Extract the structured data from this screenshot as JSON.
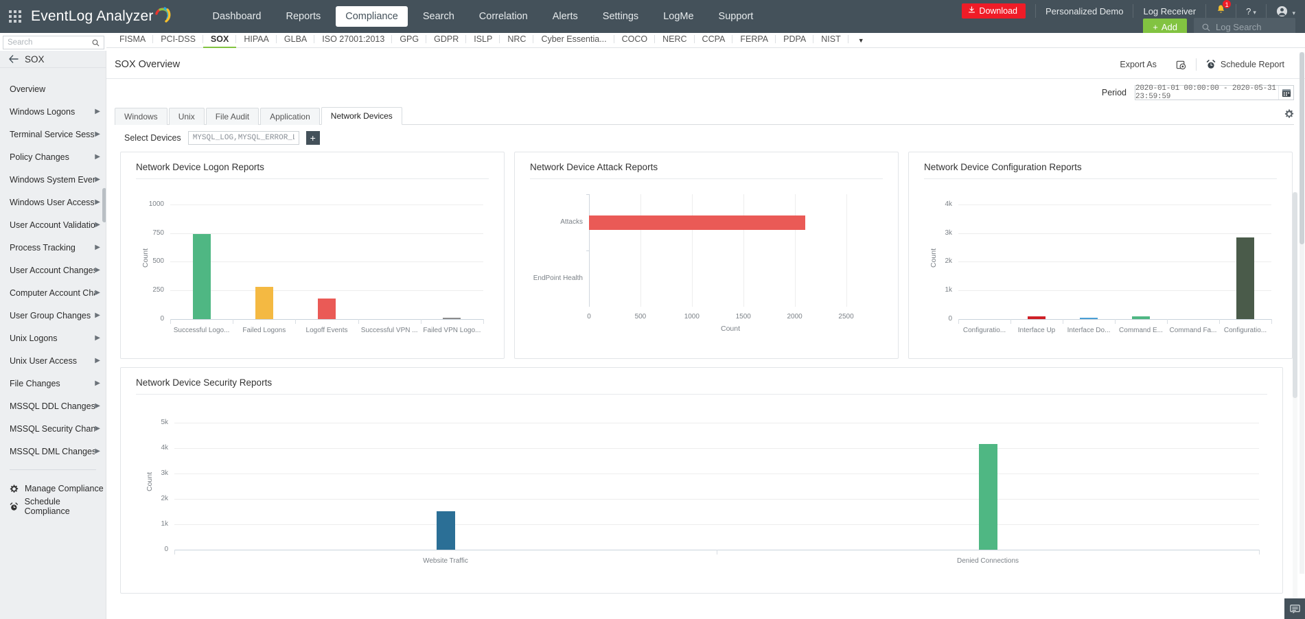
{
  "app": {
    "brand": "EventLog Analyzer",
    "grid_icon": "apps-grid-icon"
  },
  "topnav": {
    "items": [
      {
        "label": "Dashboard",
        "active": false
      },
      {
        "label": "Reports",
        "active": false
      },
      {
        "label": "Compliance",
        "active": true
      },
      {
        "label": "Search",
        "active": false
      },
      {
        "label": "Correlation",
        "active": false
      },
      {
        "label": "Alerts",
        "active": false
      },
      {
        "label": "Settings",
        "active": false
      },
      {
        "label": "LogMe",
        "active": false
      },
      {
        "label": "Support",
        "active": false
      }
    ]
  },
  "topright": {
    "download_label": "Download",
    "personalized_demo": "Personalized Demo",
    "log_receiver": "Log Receiver",
    "notification_count": "1",
    "help_label": "?",
    "add_label": "Add",
    "log_search_placeholder": "Log Search",
    "accent_red": "#ef1c27",
    "accent_green": "#82c341",
    "bar_bg": "#44515a"
  },
  "sidebar_search": {
    "placeholder": "Search"
  },
  "compliance_tabs": {
    "items": [
      {
        "label": "FISMA",
        "active": false
      },
      {
        "label": "PCI-DSS",
        "active": false
      },
      {
        "label": "SOX",
        "active": true
      },
      {
        "label": "HIPAA",
        "active": false
      },
      {
        "label": "GLBA",
        "active": false
      },
      {
        "label": "ISO 27001:2013",
        "active": false
      },
      {
        "label": "GPG",
        "active": false
      },
      {
        "label": "GDPR",
        "active": false
      },
      {
        "label": "ISLP",
        "active": false
      },
      {
        "label": "NRC",
        "active": false
      },
      {
        "label": "Cyber Essentia...",
        "active": false
      },
      {
        "label": "COCO",
        "active": false
      },
      {
        "label": "NERC",
        "active": false
      },
      {
        "label": "CCPA",
        "active": false
      },
      {
        "label": "FERPA",
        "active": false
      },
      {
        "label": "PDPA",
        "active": false
      },
      {
        "label": "NIST",
        "active": false
      }
    ]
  },
  "sidebar": {
    "header_title": "SOX",
    "items": [
      {
        "label": "Overview",
        "has_arrow": false
      },
      {
        "label": "Windows Logons",
        "has_arrow": true
      },
      {
        "label": "Terminal Service Sessi...",
        "has_arrow": true
      },
      {
        "label": "Policy Changes",
        "has_arrow": true
      },
      {
        "label": "Windows System Events",
        "has_arrow": true
      },
      {
        "label": "Windows User Access",
        "has_arrow": true
      },
      {
        "label": "User Account Validatio...",
        "has_arrow": true
      },
      {
        "label": "Process Tracking",
        "has_arrow": true
      },
      {
        "label": "User Account Changes",
        "has_arrow": true
      },
      {
        "label": "Computer Account Chang...",
        "has_arrow": true
      },
      {
        "label": "User Group Changes",
        "has_arrow": true
      },
      {
        "label": "Unix Logons",
        "has_arrow": true
      },
      {
        "label": "Unix User Access",
        "has_arrow": true
      },
      {
        "label": "File Changes",
        "has_arrow": true
      },
      {
        "label": "MSSQL DDL Changes",
        "has_arrow": true
      },
      {
        "label": "MSSQL Security Changes",
        "has_arrow": true
      },
      {
        "label": "MSSQL DML Changes",
        "has_arrow": true
      }
    ],
    "bottom_items": [
      {
        "label": "Manage Compliance",
        "icon": "gear-icon"
      },
      {
        "label": "Schedule Compliance",
        "icon": "alarm-clock-icon"
      }
    ]
  },
  "content_header": {
    "page_title": "SOX Overview",
    "export_as": "Export As",
    "schedule_report": "Schedule Report"
  },
  "period": {
    "label": "Period",
    "value": "2020-01-01 00:00:00 - 2020-05-31 23:59:59"
  },
  "page_tabs": {
    "items": [
      {
        "label": "Windows",
        "active": false
      },
      {
        "label": "Unix",
        "active": false
      },
      {
        "label": "File Audit",
        "active": false
      },
      {
        "label": "Application",
        "active": false
      },
      {
        "label": "Network Devices",
        "active": true
      }
    ]
  },
  "select_devices": {
    "label": "Select Devices",
    "value": "MYSQL_LOG,MYSQL_ERROR_LOG...",
    "add_label": "+"
  },
  "chart_data": [
    {
      "type": "bar",
      "title": "Network Device Logon Reports",
      "categories": [
        "Successful Logo...",
        "Failed Logons",
        "Logoff Events",
        "Successful VPN ...",
        "Failed VPN Logo..."
      ],
      "values": [
        740,
        281,
        180,
        0,
        8
      ],
      "colors": [
        "#4fb783",
        "#f4b942",
        "#ea5a56",
        "#5b9bd5",
        "#8c8c8c"
      ],
      "xlabel": "",
      "ylabel": "Count",
      "ylim": [
        0,
        1100
      ],
      "yticks": [
        0,
        250,
        500,
        750,
        1000
      ],
      "ytick_labels": [
        "0",
        "250",
        "500",
        "750",
        "1000"
      ],
      "grid": true
    },
    {
      "type": "bar",
      "orientation": "horizontal",
      "title": "Network Device Attack Reports",
      "categories": [
        "Attacks",
        "EndPoint Health"
      ],
      "values": [
        2100,
        0
      ],
      "colors": [
        "#ea5a56",
        "#4fb783"
      ],
      "xlabel": "Count",
      "ylabel": "",
      "xlim": [
        0,
        2750
      ],
      "xticks": [
        0,
        500,
        1000,
        1500,
        2000,
        2500
      ],
      "xtick_labels": [
        "0",
        "500",
        "1000",
        "1500",
        "2000",
        "2500"
      ],
      "grid": true
    },
    {
      "type": "bar",
      "title": "Network Device Configuration Reports",
      "categories": [
        "Configuratio...",
        "Interface Up",
        "Interface Do...",
        "Command E...",
        "Command Fa...",
        "Configuratio..."
      ],
      "values": [
        0,
        85,
        32,
        95,
        0,
        2850
      ],
      "colors": [
        "#4fb783",
        "#cf2027",
        "#4a9fd5",
        "#4fb783",
        "#f4b942",
        "#4a5b4a"
      ],
      "xlabel": "",
      "ylabel": "Count",
      "ylim": [
        0,
        4400
      ],
      "yticks": [
        0,
        1000,
        2000,
        3000,
        4000
      ],
      "ytick_labels": [
        "0",
        "1k",
        "2k",
        "3k",
        "4k"
      ],
      "grid": true
    },
    {
      "type": "bar",
      "title": "Network Device Security Reports",
      "categories": [
        "Website Traffic",
        "Denied Connections"
      ],
      "values": [
        1500,
        4150
      ],
      "colors": [
        "#2b6f96",
        "#4fb783"
      ],
      "xlabel": "",
      "ylabel": "Count",
      "ylim": [
        0,
        5500
      ],
      "yticks": [
        0,
        1000,
        2000,
        3000,
        4000,
        5000
      ],
      "ytick_labels": [
        "0",
        "1k",
        "2k",
        "3k",
        "4k",
        "5k"
      ],
      "grid": true
    }
  ]
}
